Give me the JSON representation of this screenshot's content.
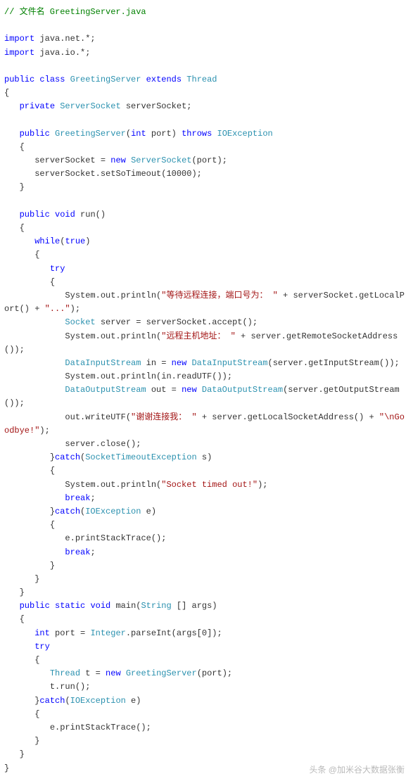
{
  "code": {
    "comment_filename": "// 文件名 GreetingServer.java",
    "import1_kw": "import",
    "import1_pkg": " java.net.*;",
    "import2_kw": "import",
    "import2_pkg": " java.io.*;",
    "class_decl_public": "public",
    "class_decl_class": "class",
    "class_name": "GreetingServer",
    "class_extends": "extends",
    "class_parent": "Thread",
    "field_private": "private",
    "field_type": "ServerSocket",
    "field_name": " serverSocket;",
    "ctor_public": "public",
    "ctor_name": "GreetingServer",
    "ctor_lp": "(",
    "ctor_int": "int",
    "ctor_port": " port) ",
    "ctor_throws": "throws",
    "ctor_exc": "IOException",
    "ctor_body1a": "      serverSocket = ",
    "ctor_body1_new": "new",
    "ctor_body1_type": "ServerSocket",
    "ctor_body1b": "(port);",
    "ctor_body2": "      serverSocket.setSoTimeout(",
    "ctor_body2_num": "10000",
    "ctor_body2b": ");",
    "run_public": "public",
    "run_void": "void",
    "run_name": " run()",
    "while_kw": "while",
    "while_cond_l": "(",
    "while_true": "true",
    "while_cond_r": ")",
    "try_kw": "try",
    "l1a": "            System.out.println(",
    "l1s": "\"等待远程连接，端口号为： \"",
    "l1b": " + serverSocket.getLocalPort() + ",
    "l1s2": "\"...\"",
    "l1c": ");",
    "l2a": "            ",
    "l2_type": "Socket",
    "l2b": " server = serverSocket.accept();",
    "l3a": "            System.out.println(",
    "l3s": "\"远程主机地址： \"",
    "l3b": " + server.getRemoteSocketAddress());",
    "l4a": "            ",
    "l4_type": "DataInputStream",
    "l4b": " in = ",
    "l4_new": "new",
    "l4_type2": "DataInputStream",
    "l4c": "(server.getInputStream());",
    "l5": "            System.out.println(in.readUTF());",
    "l6a": "            ",
    "l6_type": "DataOutputStream",
    "l6b": " out = ",
    "l6_new": "new",
    "l6_type2": "DataOutputStream",
    "l6c": "(server.getOutputStream());",
    "l7a": "            out.writeUTF(",
    "l7s": "\"谢谢连接我： \"",
    "l7b": " + server.getLocalSocketAddress() + ",
    "l7s2": "\"\\nGoodbye!\"",
    "l7c": ");",
    "l8": "            server.close();",
    "catch1a": "         }",
    "catch1_kw": "catch",
    "catch1_lp": "(",
    "catch1_type": "SocketTimeoutException",
    "catch1b": " s)",
    "catch1_body_a": "            System.out.println(",
    "catch1_body_s": "\"Socket timed out!\"",
    "catch1_body_b": ");",
    "catch1_break": "break",
    "catch2a": "         }",
    "catch2_kw": "catch",
    "catch2_lp": "(",
    "catch2_type": "IOException",
    "catch2b": " e)",
    "catch2_body": "            e.printStackTrace();",
    "catch2_break": "break",
    "main_public": "public",
    "main_static": "static",
    "main_void": "void",
    "main_name": " main(",
    "main_argtype": "String",
    "main_args": " [] args)",
    "main_l1a": "      ",
    "main_l1_int": "int",
    "main_l1b": " port = ",
    "main_l1_type": "Integer",
    "main_l1c": ".parseInt(args[",
    "main_l1_num": "0",
    "main_l1d": "]);",
    "main_try": "try",
    "main_l2a": "         ",
    "main_l2_type": "Thread",
    "main_l2b": " t = ",
    "main_l2_new": "new",
    "main_l2_type2": "GreetingServer",
    "main_l2c": "(port);",
    "main_l3": "         t.run();",
    "main_catch_a": "      }",
    "main_catch_kw": "catch",
    "main_catch_lp": "(",
    "main_catch_type": "IOException",
    "main_catch_b": " e)",
    "main_catch_body": "         e.printStackTrace();"
  },
  "watermark": "头条 @加米谷大数据张衡"
}
